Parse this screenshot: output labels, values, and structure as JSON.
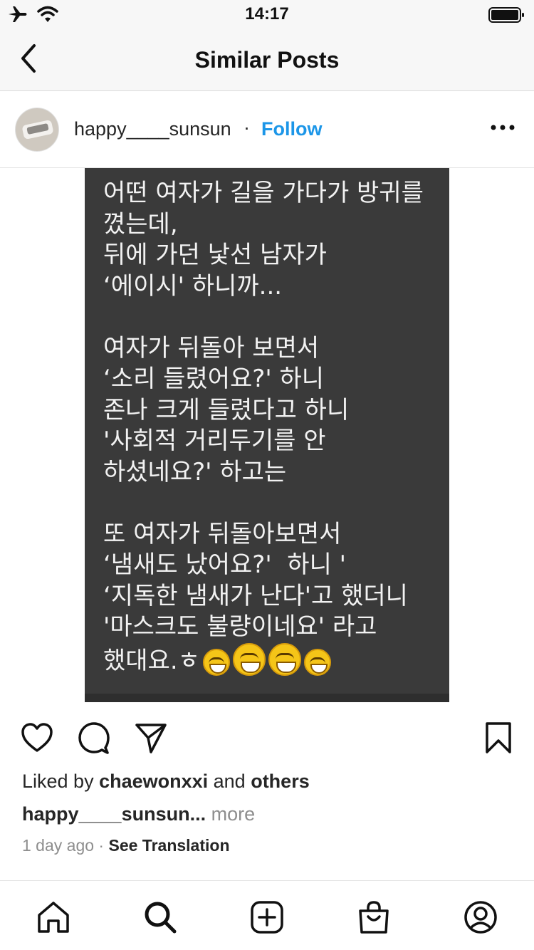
{
  "status_bar": {
    "time": "14:17",
    "icons": [
      "airplane-icon",
      "wifi-icon",
      "battery-icon"
    ]
  },
  "nav": {
    "title": "Similar Posts",
    "back_icon": "chevron-left-icon"
  },
  "post": {
    "username": "happy____sunsun",
    "separator": "·",
    "follow_label": "Follow",
    "more_icon": "more-horizontal-icon",
    "image_text": "어떤 여자가 길을 가다가 방귀를\n꼈는데,\n뒤에 가던 낯선 남자가\n‘에이시' 하니까...\n\n여자가 뒤돌아 보면서\n‘소리 들렸어요?' 하니\n존나 크게 들렸다고 하니\n'사회적 거리두기를 안\n하셨네요?' 하고는\n\n또 여자가 뒤돌아보면서\n‘냄새도 났어요?'  하니 '\n‘지독한 냄새가 난다'고 했더니\n'마스크도 불량이네요' 라고\n",
    "image_last_line": "했대요.ㅎ",
    "image_emojis": [
      "rofl-emoji",
      "grinning-emoji",
      "grinning-emoji",
      "laughing-emoji"
    ],
    "liked_prefix": "Liked by ",
    "liked_user": "chaewonxxi",
    "liked_mid": " and ",
    "liked_others": "others",
    "caption_user": "happy____sunsun...",
    "caption_more": " more",
    "time_ago": "1 day ago",
    "meta_sep": " · ",
    "see_translation": "See Translation"
  },
  "actions": [
    "heart-icon",
    "comment-icon",
    "send-icon",
    "bookmark-icon"
  ],
  "tab_bar": [
    "home-icon",
    "search-icon",
    "create-icon",
    "shop-icon",
    "profile-icon"
  ],
  "colors": {
    "accent": "#1c96e8",
    "image_bg": "#3a3a3a",
    "bar_bg": "#f7f7f7"
  }
}
